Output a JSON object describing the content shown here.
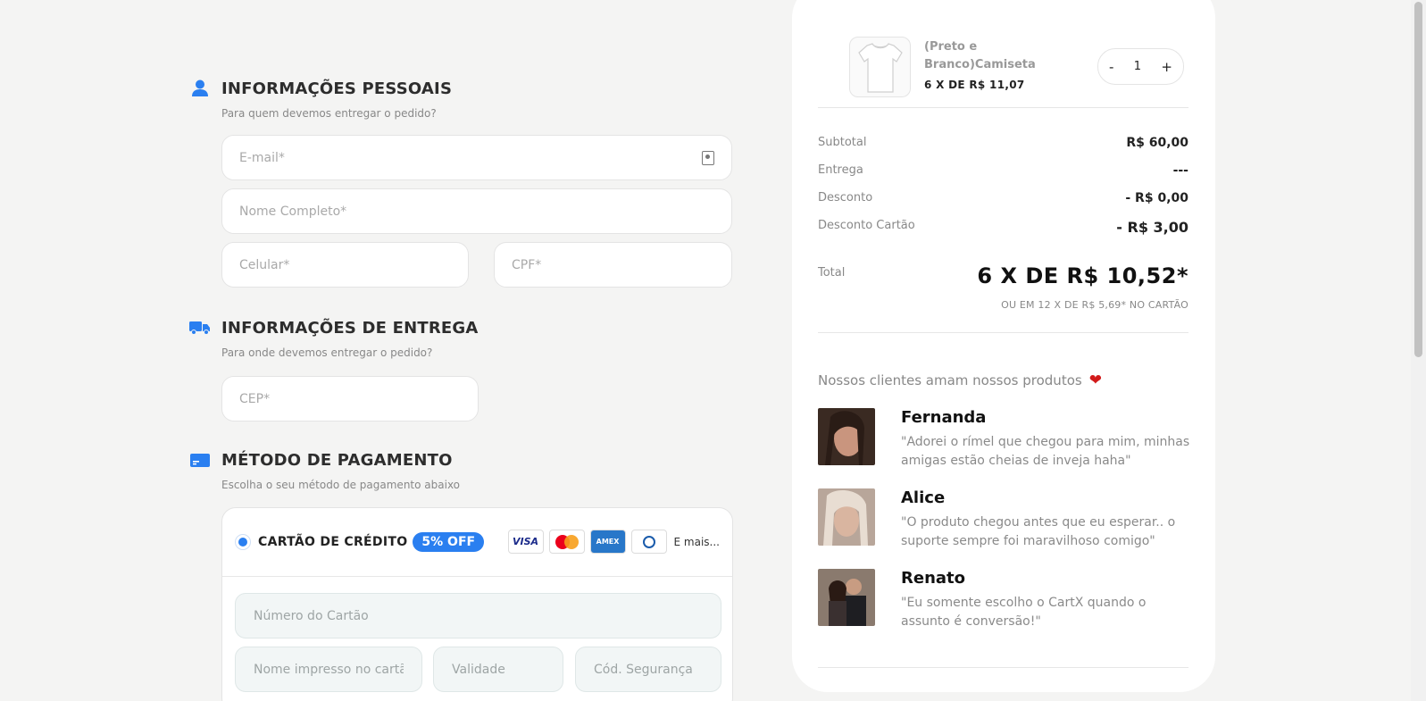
{
  "personal": {
    "title": "INFORMAÇÕES PESSOAIS",
    "subtitle": "Para quem devemos entregar o pedido?",
    "email_placeholder": "E-mail*",
    "name_placeholder": "Nome Completo*",
    "phone_placeholder": "Celular*",
    "cpf_placeholder": "CPF*"
  },
  "delivery": {
    "title": "INFORMAÇÕES DE ENTREGA",
    "subtitle": "Para onde devemos entregar o pedido?",
    "cep_placeholder": "CEP*"
  },
  "payment": {
    "title": "MÉTODO DE PAGAMENTO",
    "subtitle": "Escolha o seu método de pagamento abaixo",
    "method_label": "CARTÃO DE CRÉDITO",
    "discount_badge": "5% OFF",
    "brands": [
      "VISA",
      "MASTERCARD",
      "AMEX",
      "DINERS"
    ],
    "more_label": "E mais...",
    "card_number_placeholder": "Número do Cartão",
    "card_name_placeholder": "Nome impresso no cartão",
    "expiry_placeholder": "Validade",
    "cvv_placeholder": "Cód. Segurança"
  },
  "summary": {
    "product": {
      "name": "(Preto e Branco)Camiseta",
      "price": "6 X DE R$ 11,07",
      "quantity": "1",
      "minus": "-",
      "plus": "+"
    },
    "rows": [
      {
        "label": "Subtotal",
        "value": "R$ 60,00"
      },
      {
        "label": "Entrega",
        "value": "---"
      },
      {
        "label": "Desconto",
        "value": "- R$ 0,00"
      },
      {
        "label": "Desconto Cartão",
        "value": "- R$ 3,00"
      }
    ],
    "total_label": "Total",
    "total_value": "6 X DE R$ 10,52*",
    "total_sub": "OU EM 12 X DE R$ 5,69* NO CARTÃO"
  },
  "testimonials": {
    "heading": "Nossos clientes amam nossos produtos",
    "items": [
      {
        "name": "Fernanda",
        "text": "\"Adorei o rímel que chegou para mim, minhas amigas estão cheias de inveja haha\""
      },
      {
        "name": "Alice",
        "text": "\"O produto chegou antes que eu esperar.. o suporte sempre foi maravilhoso comigo\""
      },
      {
        "name": "Renato",
        "text": "\"Eu somente escolho o CartX quando o assunto é conversão!\""
      }
    ]
  },
  "colors": {
    "accent": "#2a7ff0",
    "background": "#f4f4f3",
    "heart": "#d21a1a"
  }
}
